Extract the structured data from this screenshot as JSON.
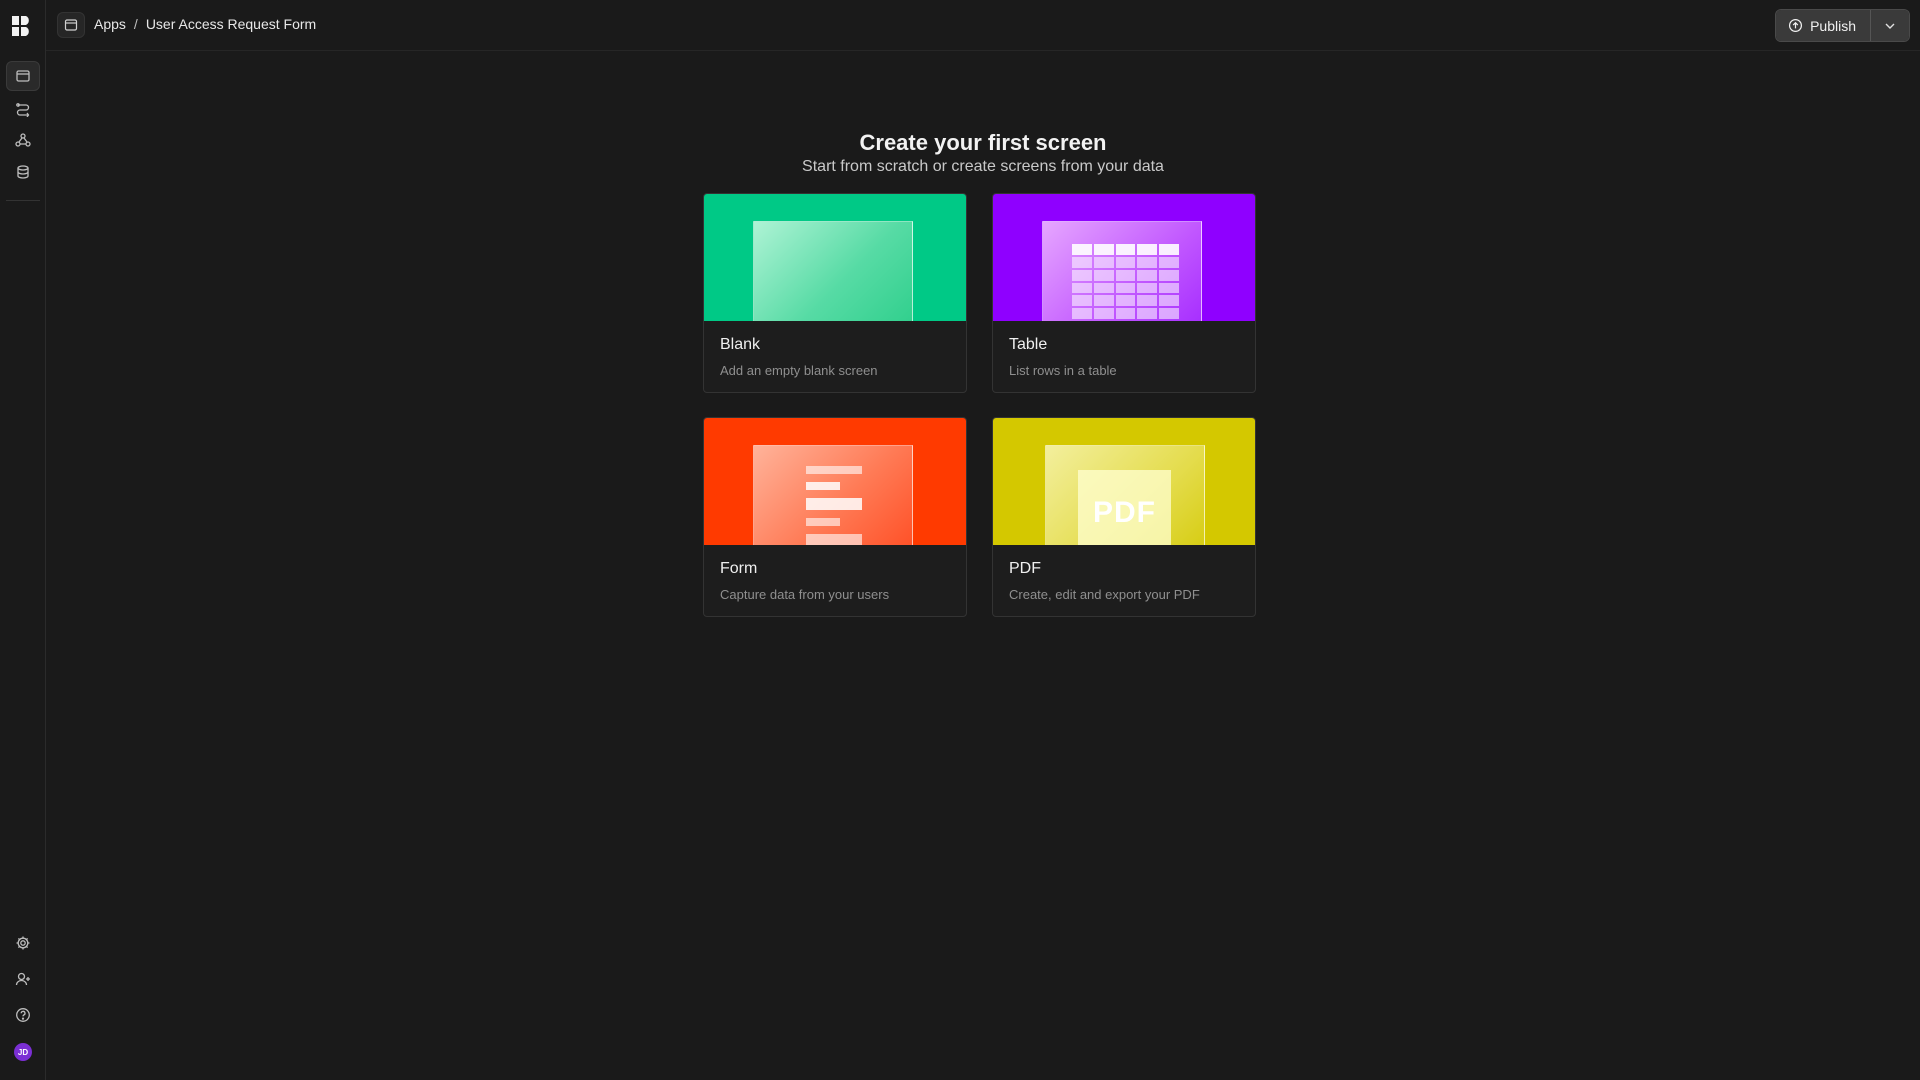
{
  "header": {
    "breadcrumb": [
      "Apps",
      "User Access Request Form"
    ],
    "separator": "/",
    "publish_label": "Publish"
  },
  "rail": {
    "top_icons": [
      "screens-icon",
      "automations-icon",
      "workflow-icon",
      "database-icon"
    ],
    "bottom_icons": [
      "settings-icon",
      "add-user-icon",
      "help-icon"
    ],
    "avatar_initials": "JD",
    "avatar_color": "#7b2fd4"
  },
  "main": {
    "title": "Create your first screen",
    "subtitle": "Start from scratch or create screens from your data",
    "cards": [
      {
        "name": "Blank",
        "desc": "Add an empty blank screen",
        "color": "#00c986"
      },
      {
        "name": "Table",
        "desc": "List rows in a table",
        "color": "#8f00ff"
      },
      {
        "name": "Form",
        "desc": "Capture data from your users",
        "color": "#ff3a00"
      },
      {
        "name": "PDF",
        "desc": "Create, edit and export your PDF",
        "color": "#d4c800",
        "preview_text": "PDF"
      }
    ]
  }
}
